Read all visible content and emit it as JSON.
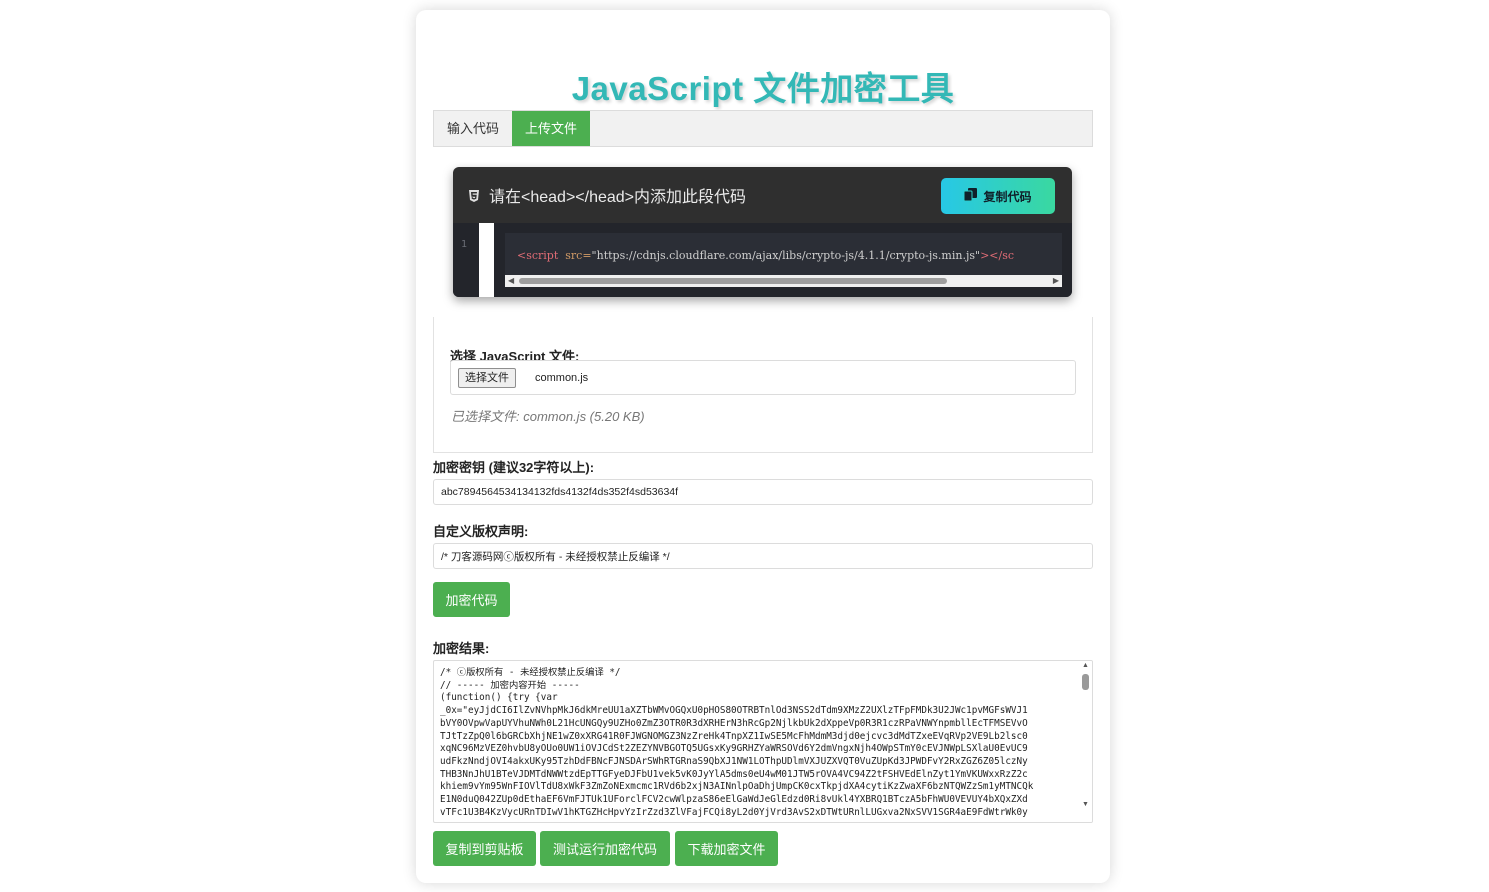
{
  "title": "JavaScript 文件加密工具",
  "tabs": [
    {
      "label": "输入代码",
      "active": false
    },
    {
      "label": "上传文件",
      "active": true
    }
  ],
  "notice": {
    "heading": "请在<head></head>内添加此段代码",
    "copy_label": "复制代码",
    "line_number": "1",
    "code_tag": "<script",
    "code_attr": "src=",
    "code_value": "\"https://cdnjs.cloudflare.com/ajax/libs/crypto-js/4.1.1/crypto-js.min.js\"",
    "code_tail": "></sc"
  },
  "file_section": {
    "label": "选择 JavaScript 文件:",
    "choose_button": "选择文件",
    "file_name": "common.js",
    "selected_info": "已选择文件: common.js (5.20 KB)"
  },
  "key_section": {
    "label": "加密密钥 (建议32字符以上):",
    "value": "abc7894564534134132fds4132f4ds352f4sd53634f"
  },
  "copyright_section": {
    "label": "自定义版权声明:",
    "value": "/* 刀客源码网ⓒ版权所有 - 未经授权禁止反编译 */"
  },
  "encrypt_button": "加密代码",
  "result_section": {
    "label": "加密结果:",
    "content": "/* ⓒ版权所有 - 未经授权禁止反编译 */\n// ----- 加密内容开始 -----\n(function() {try {var\n_0x=\"eyJjdCI6IlZvNVhpMkJ6dkMreUU1aXZTbWMvOGQxU0pHOS80OTRBTnlOd3NSS2dTdm9XMzZ2UXlzTFpFMDk3U2JWc1pvMGFsWVJ1\nbVY0OVpwVapUYVhuNWh0L21HcUNGQy9UZHo0ZmZ3OTR0R3dXRHErN3hRcGp2NjlkbUk2dXppeVp0R3R1czRPaVNWYnpmbllEcTFMSEVvO\nTJtTzZpQ0l6bGRCbXhjNE1wZ0xXRG41R0FJWGNOMGZ3NzZreHk4TnpXZ1IwSE5McFhMdmM3djd0ejcvc3dMdTZxeEVqRVp2VE9Lb2lsc0\nxqNC96MzVEZ0hvbU8yOUo0UW1iOVJCdSt2ZEZYNVBGOTQ5UGsxKy9GRHZYaWRSOVd6Y2dmVngxNjh4OWpSTmY0cEVJNWpLSXlaU0EvUC9\nudFkzNndjOVI4akxUKy95TzhDdFBNcFJNSDArSWhRTGRnaS9QbXJ1NW1LOThpUDlmVXJUZXVQT0VuZUpKd3JPWDFvY2RxZGZ6Z05lczNy\nTHB3NnJhU1BTeVJDMTdNWWtzdEpTTGFyeDJFbU1vek5vK0JyYlA5dms0eU4wM01JTW5rOVA4VC94Z2tFSHVEdElnZyt1YmVKUWxxRzZ2c\nkhiem9vYm95WnFIOVlTdU8xWkF3ZmZoNExmcmc1RVd6b2xjN3AINnlpOaDhjUmpCK0cxTkpjdXA4cytiKzZwaXF6bzNTQWZzSm1yMTNCQk\nE1N0duQ042ZUp0dEthaEF6VmFJTUk1UForclFCV2cwWlpzaS86eElGaWdJeGlEdzd0Ri8vUkl4YXBRQ1BTczA5bFhWU0VEVUY4bXQxZXd\nvTFc1U3B4KzVycURnTDIwV1hKTGZHcHpvYzIrZzd3ZlVFajFCQi8yL2d0YjVrd3AvS2xDTWtURnlLUGxva2NxSVV1SGR4aE9FdWtrWk0y"
  },
  "action_buttons": {
    "copy": "复制到剪贴板",
    "test_run": "测试运行加密代码",
    "download": "下载加密文件"
  },
  "colors": {
    "accent_green": "#4caf50",
    "title_teal": "#33b8b6",
    "notice_bg": "#2f2f2f"
  }
}
